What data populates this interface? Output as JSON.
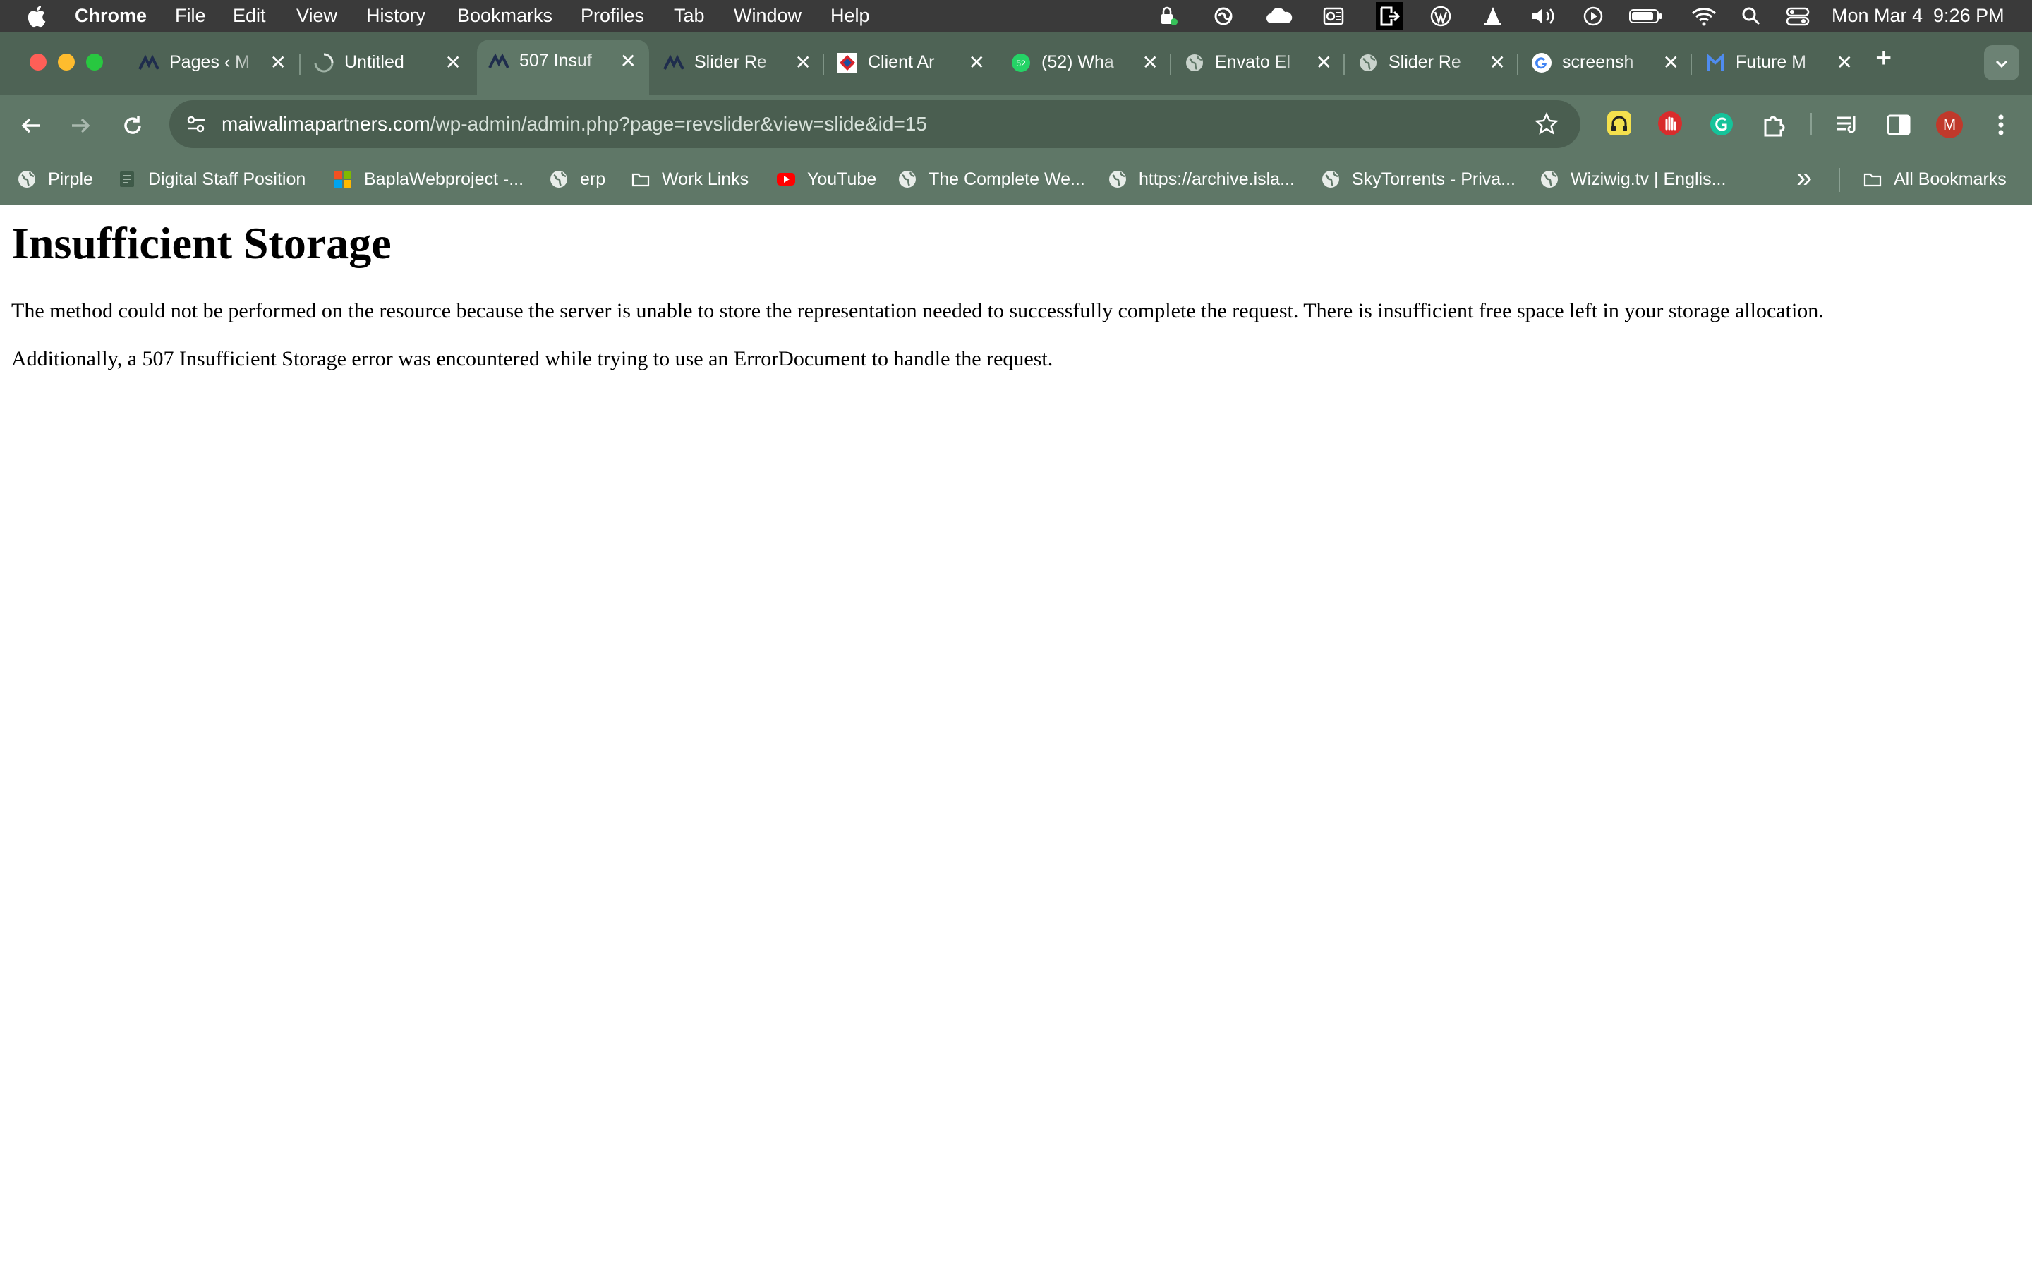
{
  "menubar": {
    "app": "Chrome",
    "items": [
      "File",
      "Edit",
      "View",
      "History",
      "Bookmarks",
      "Profiles",
      "Tab",
      "Window",
      "Help"
    ],
    "status_icons": [
      "lock-badge-icon",
      "creative-cloud-icon",
      "cloud-icon",
      "outlook-icon",
      "exit-icon",
      "wordpress-icon",
      "vlc-icon",
      "volume-icon",
      "play-icon",
      "battery-icon",
      "wifi-icon",
      "search-icon",
      "control-center-icon"
    ],
    "datetime": "Mon Mar 4  9:26 PM"
  },
  "tabs": [
    {
      "title": "Pages ‹ M",
      "icon": "site-logo-icon"
    },
    {
      "title": "Untitled",
      "icon": "loading-spinner-icon"
    },
    {
      "title": "507 Insuf",
      "icon": "site-logo-icon",
      "active": true
    },
    {
      "title": "Slider Re",
      "icon": "site-logo-icon"
    },
    {
      "title": "Client Ar",
      "icon": "client-area-icon"
    },
    {
      "title": "(52) Wha",
      "icon": "whatsapp-icon"
    },
    {
      "title": "Envato El",
      "icon": "globe-icon"
    },
    {
      "title": "Slider Re",
      "icon": "globe-icon"
    },
    {
      "title": "screensh",
      "icon": "google-icon"
    },
    {
      "title": "Future M",
      "icon": "future-m-icon"
    }
  ],
  "toolbar": {
    "url_domain": "maiwalimapartners.com",
    "url_path": "/wp-admin/admin.php?page=revslider&view=slide&id=15",
    "profile_initial": "M"
  },
  "bookmarks": [
    {
      "label": "Pirple",
      "icon": "globe-icon"
    },
    {
      "label": "Digital Staff Position",
      "icon": "document-icon"
    },
    {
      "label": "BaplaWebproject -...",
      "icon": "microsoft-icon"
    },
    {
      "label": "erp",
      "icon": "globe-icon"
    },
    {
      "label": "Work Links",
      "icon": "folder-icon"
    },
    {
      "label": "YouTube",
      "icon": "youtube-icon"
    },
    {
      "label": "The Complete We...",
      "icon": "globe-icon"
    },
    {
      "label": "https://archive.isla...",
      "icon": "globe-icon"
    },
    {
      "label": "SkyTorrents - Priva...",
      "icon": "globe-icon"
    },
    {
      "label": "Wiziwig.tv | Englis...",
      "icon": "globe-icon"
    }
  ],
  "bookmarks_more": "»",
  "all_bookmarks": "All Bookmarks",
  "page": {
    "heading": "Insufficient Storage",
    "paragraph1": "The method could not be performed on the resource because the server is unable to store the representation needed to successfully complete the request. There is insufficient free space left in your storage allocation.",
    "paragraph2": "Additionally, a 507 Insufficient Storage error was encountered while trying to use an ErrorDocument to handle the request."
  },
  "colors": {
    "menubar": "#3a3a3a",
    "tabstrip": "#4e6355",
    "toolbar": "#5f7767",
    "omnibox": "#4a5e50"
  }
}
